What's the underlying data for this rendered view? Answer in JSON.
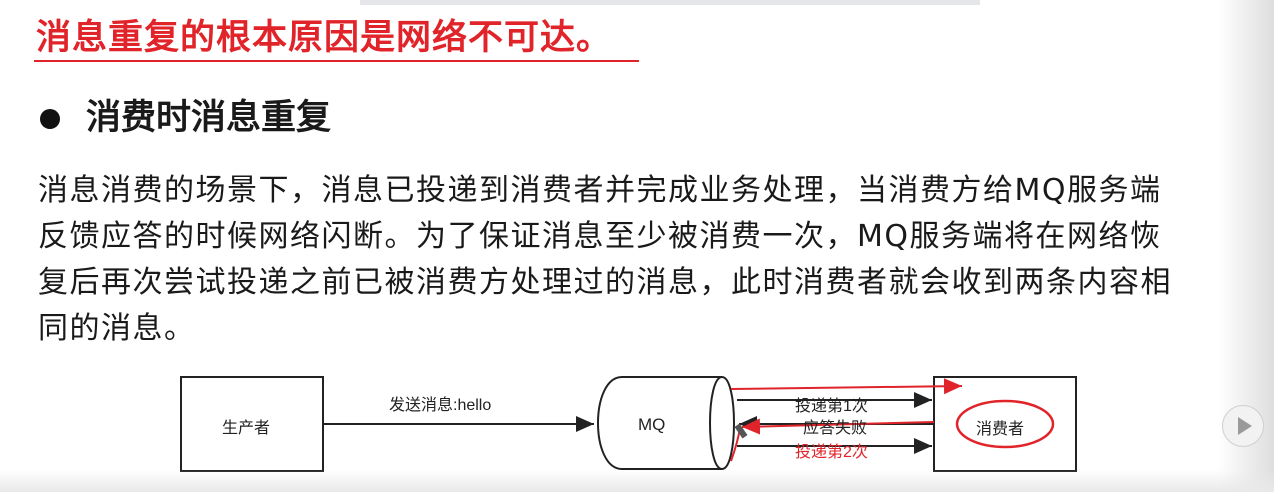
{
  "headline": "消息重复的根本原因是网络不可达。",
  "section_bullet": "消费时消息重复",
  "paragraph_lines": [
    "消息消费的场景下，消息已投递到消费者并完成业务处理，当消费方给MQ服务端",
    "反馈应答的时候网络闪断。为了保证消息至少被消费一次，MQ服务端将在网络恢",
    "复后再次尝试投递之前已被消费方处理过的消息，此时消费者就会收到两条内容相",
    "同的消息。"
  ],
  "diagram": {
    "producer": "生产者",
    "send_label": "发送消息:hello",
    "mq": "MQ",
    "deliver_first": "投递第1次",
    "ack_failed": "应答失败",
    "deliver_second": "投递第2次",
    "consumer": "消费者"
  },
  "colors": {
    "accent_red": "#e0242a",
    "text": "#1a1a1a",
    "line": "#222222"
  },
  "icons": {
    "bullet": "bullet-dot-icon",
    "player": "play-icon"
  }
}
